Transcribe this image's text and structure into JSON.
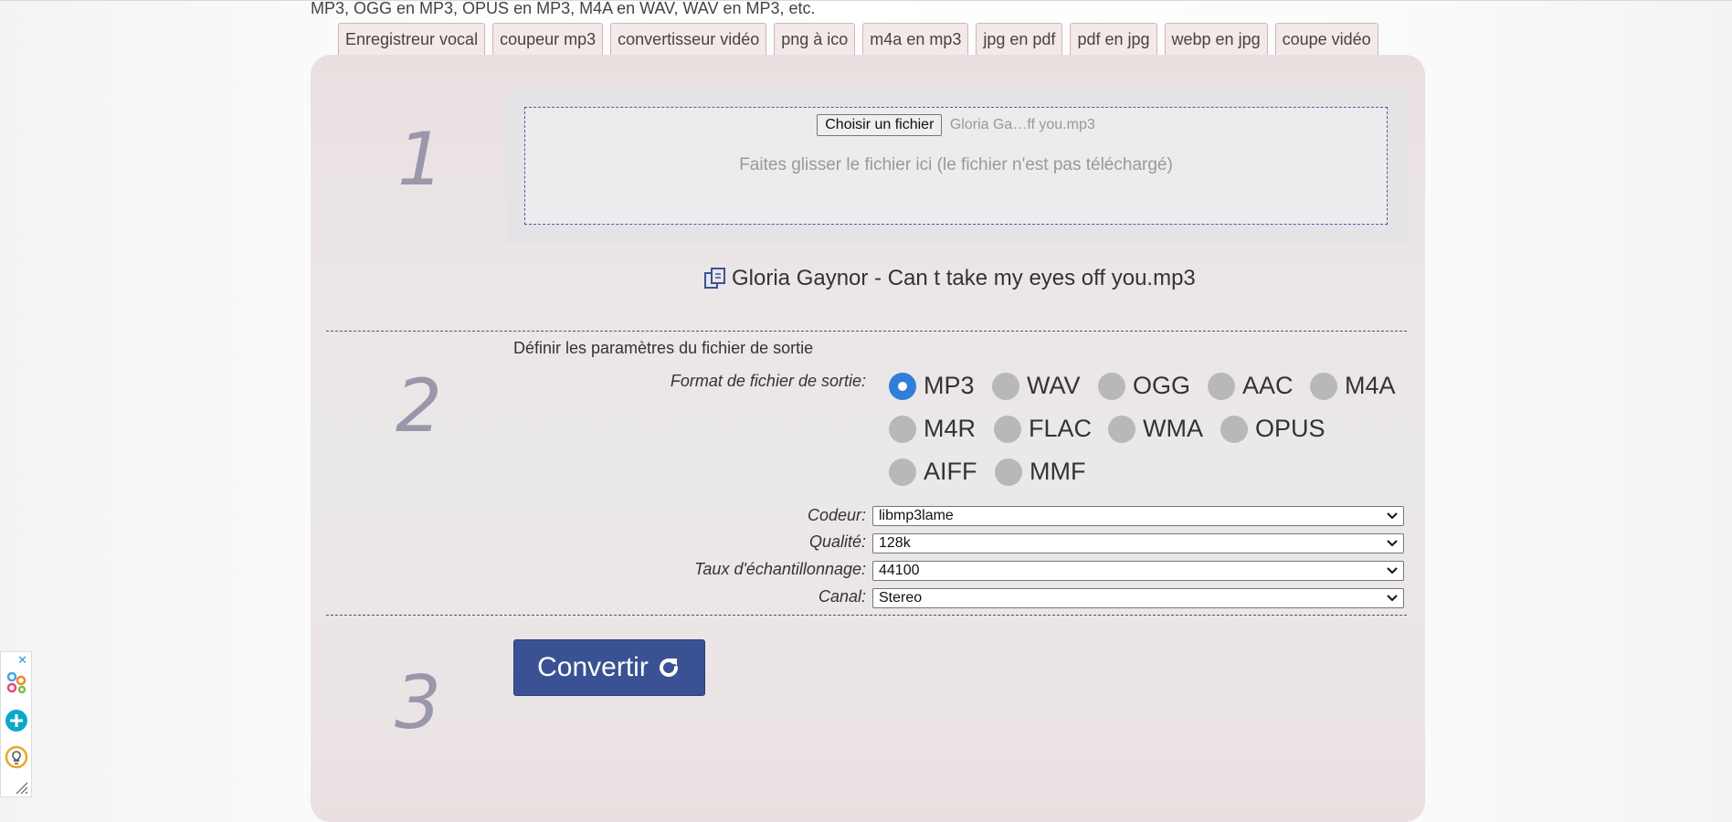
{
  "intro_text": "MP3, OGG en MP3, OPUS en MP3, M4A en WAV, WAV en MP3, etc.",
  "tabs": [
    {
      "label": "Enregistreur vocal"
    },
    {
      "label": "coupeur mp3"
    },
    {
      "label": "convertisseur vidéo"
    },
    {
      "label": "png à ico"
    },
    {
      "label": "m4a en mp3"
    },
    {
      "label": "jpg en pdf"
    },
    {
      "label": "pdf en jpg"
    },
    {
      "label": "webp en jpg"
    },
    {
      "label": "coupe vidéo"
    }
  ],
  "steps": {
    "one": "1",
    "two": "2",
    "three": "3"
  },
  "upload": {
    "button_label": "Choisir un fichier",
    "chosen_file_short": "Gloria Ga…ff you.mp3",
    "drop_hint": "Faites glisser le fichier ici (le fichier n'est pas téléchargé)",
    "file_name": "Gloria Gaynor - Can t take my eyes off you.mp3"
  },
  "settings": {
    "section_title": "Définir les paramètres du fichier de sortie",
    "format_label": "Format de fichier de sortie:",
    "formats": [
      "MP3",
      "WAV",
      "OGG",
      "AAC",
      "M4A",
      "M4R",
      "FLAC",
      "WMA",
      "OPUS",
      "AIFF",
      "MMF"
    ],
    "selected_format": "MP3",
    "codec_label": "Codeur:",
    "codec_value": "libmp3lame",
    "quality_label": "Qualité:",
    "quality_value": "128k",
    "samplerate_label": "Taux d'échantillonnage:",
    "samplerate_value": "44100",
    "channel_label": "Canal:",
    "channel_value": "Stereo"
  },
  "convert": {
    "label": "Convertir"
  },
  "colors": {
    "accent": "#3a5294",
    "radio_selected": "#2f7ed8",
    "step_number": "#9b97aa"
  }
}
